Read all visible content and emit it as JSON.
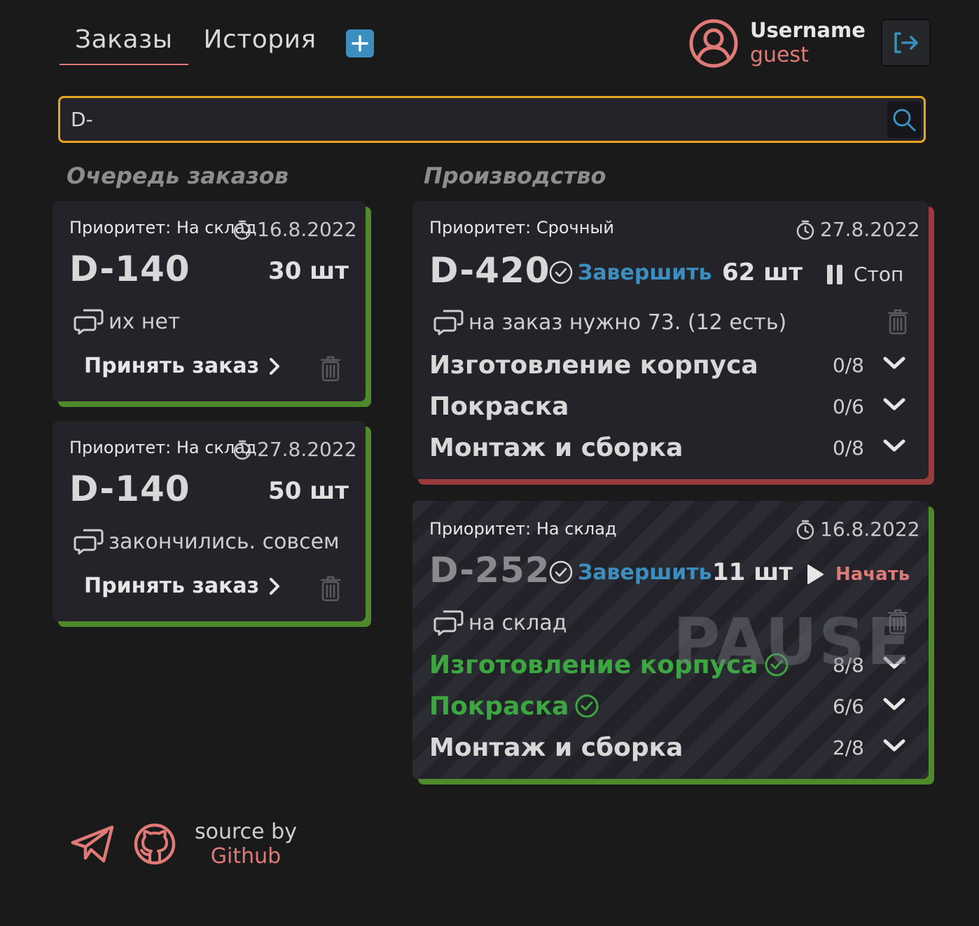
{
  "nav": {
    "tabs": [
      {
        "label": "Заказы",
        "active": true
      },
      {
        "label": "История",
        "active": false
      }
    ],
    "add_icon": "plus-icon"
  },
  "user": {
    "name": "Username",
    "role": "guest",
    "avatar_icon": "user-circle-icon",
    "logout_icon": "logout-icon"
  },
  "search": {
    "value": "D-",
    "placeholder": "",
    "icon": "search-icon"
  },
  "sections": {
    "queue_title": "Очередь заказов",
    "production_title": "Производство"
  },
  "queue": [
    {
      "priority": "Приоритет: На склад",
      "date": "16.8.2022",
      "code": "D-140",
      "qty": "30 шт",
      "comment": "их нет",
      "accept_label": "Принять заказ"
    },
    {
      "priority": "Приоритет: На склад",
      "date": "27.8.2022",
      "code": "D-140",
      "qty": "50 шт",
      "comment": "закончились. совсем",
      "accept_label": "Принять заказ"
    }
  ],
  "production": [
    {
      "priority": "Приоритет: Срочный",
      "date": "27.8.2022",
      "code": "D-420",
      "finish_label": "Завершить",
      "qty": "62 шт",
      "action_label": "Стоп",
      "comment": "на заказ нужно 73. (12 есть)",
      "stages": [
        {
          "name": "Изготовление корпуса",
          "count": "0/8",
          "done": false
        },
        {
          "name": "Покраска",
          "count": "0/6",
          "done": false
        },
        {
          "name": "Монтаж и сборка",
          "count": "0/8",
          "done": false
        }
      ]
    },
    {
      "priority": "Приоритет: На склад",
      "date": "16.8.2022",
      "code": "D-252",
      "finish_label": "Завершить",
      "qty": "11 шт",
      "action_label": "Начать",
      "comment": "на склад",
      "watermark": "PAUSE",
      "stages": [
        {
          "name": "Изготовление корпуса",
          "count": "8/8",
          "done": true
        },
        {
          "name": "Покраска",
          "count": "6/6",
          "done": true
        },
        {
          "name": "Монтаж и сборка",
          "count": "2/8",
          "done": false
        }
      ]
    }
  ],
  "footer": {
    "source_label": "source by",
    "source_link": "Github",
    "telegram_icon": "telegram-icon",
    "github_icon": "github-icon"
  },
  "colors": {
    "background": "#1a1a1b",
    "card": "#232329",
    "accent_red": "#e07a76",
    "accent_blue": "#3a8fbf",
    "accent_yellow": "#e8a51f",
    "status_green": "#4e8a2a",
    "status_red": "#9a3a3a",
    "done_green": "#3ca640"
  }
}
